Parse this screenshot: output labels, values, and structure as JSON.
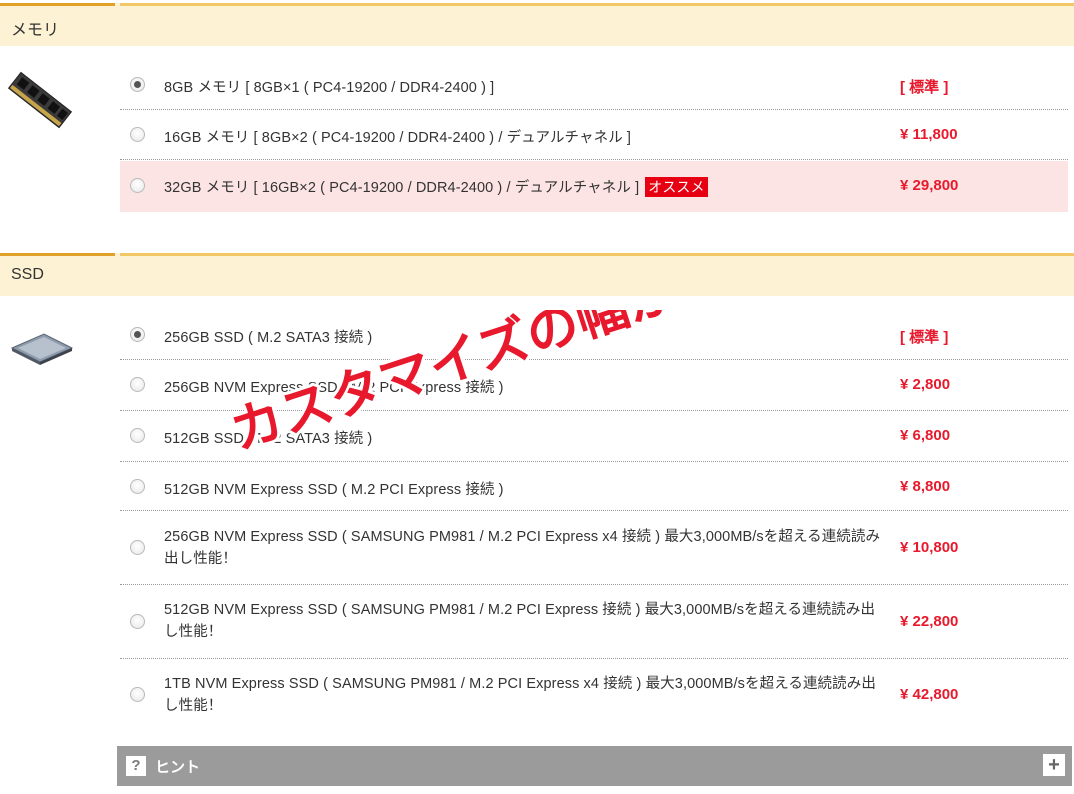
{
  "colors": {
    "accent_price": "#e8192c",
    "header_bg": "#fdf2d4",
    "header_stripe": "#e0a126",
    "highlight_row": "#fde4e4",
    "badge_bg": "#e60012",
    "hint_bar_bg": "#9b9b9b",
    "overlay_text": "#e8192c"
  },
  "memory": {
    "title": "メモリ",
    "image_icon": "memory-module-icon",
    "options": [
      {
        "label": "8GB メモリ [ 8GB×1 ( PC4-19200 / DDR4-2400 ) ]",
        "price": "[ 標準 ]",
        "selected": true
      },
      {
        "label": "16GB メモリ [ 8GB×2 ( PC4-19200 / DDR4-2400 ) / デュアルチャネル ]",
        "price": "¥ 11,800",
        "selected": false
      },
      {
        "label": "32GB メモリ [ 16GB×2 ( PC4-19200 / DDR4-2400 ) / デュアルチャネル ]",
        "badge": "オススメ",
        "price": "¥ 29,800",
        "selected": false
      }
    ]
  },
  "ssd": {
    "title": "SSD",
    "image_icon": "ssd-drive-icon",
    "options": [
      {
        "label": "256GB SSD ( M.2 SATA3 接続 )",
        "price": "[ 標準 ]",
        "selected": true
      },
      {
        "label": "256GB NVM Express SSD ( M.2 PCI Express 接続 )",
        "price": "¥ 2,800",
        "selected": false
      },
      {
        "label": "512GB SSD ( M.2 SATA3 接続 )",
        "price": "¥ 6,800",
        "selected": false
      },
      {
        "label": "512GB NVM Express SSD ( M.2 PCI Express 接続 )",
        "price": "¥ 8,800",
        "selected": false
      },
      {
        "label": "256GB NVM Express SSD ( SAMSUNG PM981 / M.2 PCI Express x4 接続 ) 最大3,000MB/sを超える連続読み出し性能！",
        "price": "¥ 10,800",
        "selected": false
      },
      {
        "label": "512GB NVM Express SSD ( SAMSUNG PM981 / M.2 PCI Express 接続 ) 最大3,000MB/sを超える連続読み出し性能！",
        "price": "¥ 22,800",
        "selected": false
      },
      {
        "label": "1TB NVM Express SSD ( SAMSUNG PM981 / M.2 PCI Express x4 接続 ) 最大3,000MB/sを超える連続読み出し性能！",
        "price": "¥ 42,800",
        "selected": false
      }
    ]
  },
  "hint": {
    "question_icon": "?",
    "label": "ヒント",
    "expand_icon": "+"
  },
  "overlay": {
    "text": "カスタマイズの幅が豊富"
  }
}
